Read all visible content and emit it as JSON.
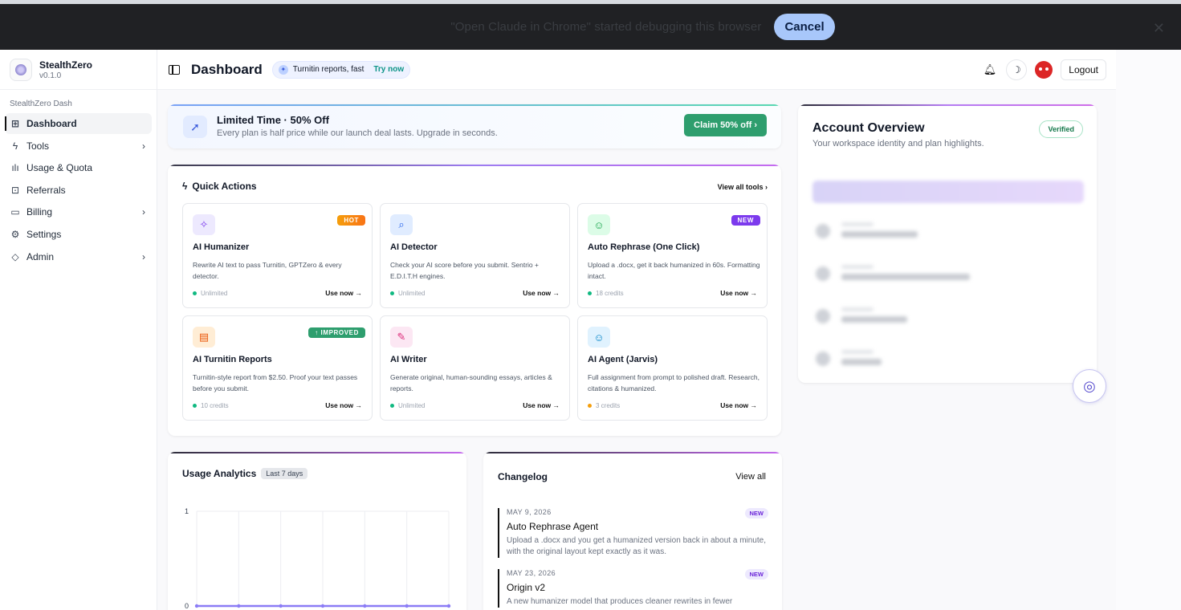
{
  "debug_bar": {
    "message": "\"Open Claude in Chrome\" started debugging this browser",
    "cancel_label": "Cancel",
    "close_glyph": "✕"
  },
  "sidebar": {
    "brand_name": "StealthZero",
    "version": "v0.1.0",
    "section": "StealthZero Dash",
    "items": [
      {
        "label": "Dashboard",
        "icon": "⊞",
        "active": true
      },
      {
        "label": "Tools",
        "icon": "ϟ",
        "chevron": "›"
      },
      {
        "label": "Usage & Quota",
        "icon": "ılı"
      },
      {
        "label": "Referrals",
        "icon": "⊡"
      },
      {
        "label": "Billing",
        "icon": "▭",
        "chevron": "›"
      },
      {
        "label": "Settings",
        "icon": "⚙"
      },
      {
        "label": "Admin",
        "icon": "◇",
        "chevron": "›"
      }
    ]
  },
  "header": {
    "title": "Dashboard",
    "pill_text": "Turnitin reports, fast",
    "pill_cta": "Try now",
    "logout_label": "Logout"
  },
  "promo": {
    "title": "Limited Time · 50% Off",
    "subtitle": "Every plan is half price while our launch deal lasts. Upgrade in seconds.",
    "button": "Claim 50% off  ›"
  },
  "quick_actions": {
    "title": "Quick Actions",
    "view_all": "View all tools ›",
    "tools": [
      {
        "title": "AI Humanizer",
        "desc": "Rewrite AI text to pass Turnitin, GPTZero & every detector.",
        "meta": "Unlimited",
        "badge": "HOT",
        "use": "Use now →"
      },
      {
        "title": "AI Detector",
        "desc": "Check your AI score before you submit. Sentrio + E.D.I.T.H engines.",
        "meta": "Unlimited",
        "badge": "",
        "use": "Use now →"
      },
      {
        "title": "Auto Rephrase (One Click)",
        "desc": "Upload a .docx, get it back humanized in 60s. Formatting intact.",
        "meta": "18 credits",
        "badge": "NEW",
        "use": "Use now →"
      },
      {
        "title": "AI Turnitin Reports",
        "desc": "Turnitin-style report from $2.50. Proof your text passes before you submit.",
        "meta": "10 credits",
        "badge": "↑ IMPROVED",
        "use": "Use now →"
      },
      {
        "title": "AI Writer",
        "desc": "Generate original, human-sounding essays, articles & reports.",
        "meta": "Unlimited",
        "badge": "",
        "use": "Use now →"
      },
      {
        "title": "AI Agent (Jarvis)",
        "desc": "Full assignment from prompt to polished draft. Research, citations & humanized.",
        "meta": "3 credits",
        "badge": "",
        "use": "Use now →"
      }
    ]
  },
  "account": {
    "title": "Account Overview",
    "subtitle": "Your workspace identity and plan highlights.",
    "verified": "Verified"
  },
  "usage": {
    "title": "Usage Analytics",
    "range": "Last 7 days"
  },
  "chart_data": {
    "type": "line",
    "x": [
      1,
      2,
      3,
      4,
      5,
      6,
      7
    ],
    "series": [
      {
        "values": [
          0,
          0,
          0,
          0,
          0,
          0,
          0
        ]
      }
    ],
    "yticks": [
      "1",
      "0"
    ],
    "ylim": [
      0,
      1
    ],
    "grid": true,
    "color": "#8b7cf6"
  },
  "changelog": {
    "title": "Changelog",
    "view_all": "View all",
    "entries": [
      {
        "date": "MAY 9, 2026",
        "badge": "NEW",
        "name": "Auto Rephrase Agent",
        "desc": "Upload a .docx and you get a humanized version back in about a minute, with the original layout kept exactly as it was."
      },
      {
        "date": "MAY 23, 2026",
        "badge": "NEW",
        "name": "Origin v2",
        "desc": "A new humanizer model that produces cleaner rewrites in fewer"
      }
    ]
  }
}
